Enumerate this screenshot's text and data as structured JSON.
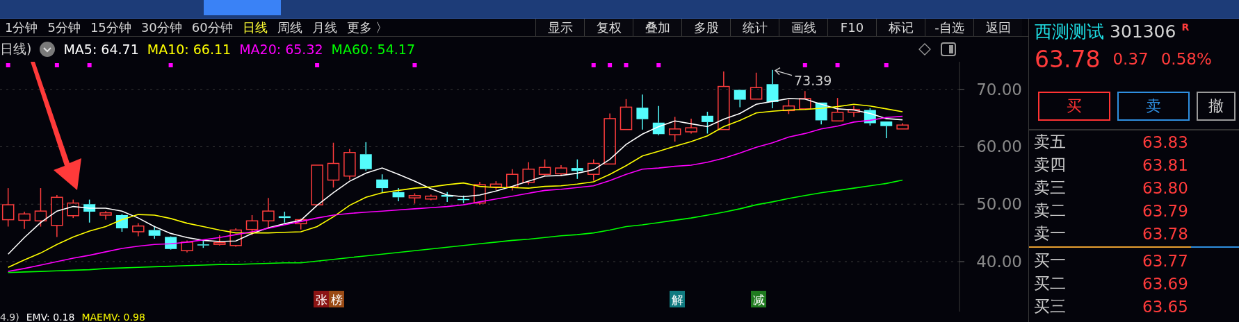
{
  "periods": [
    {
      "label": "1分钟",
      "selected": false
    },
    {
      "label": "5分钟",
      "selected": false
    },
    {
      "label": "15分钟",
      "selected": false
    },
    {
      "label": "30分钟",
      "selected": false
    },
    {
      "label": "60分钟",
      "selected": false
    },
    {
      "label": "日线",
      "selected": true
    },
    {
      "label": "周线",
      "selected": false
    },
    {
      "label": "月线",
      "selected": false
    },
    {
      "label": "更多 〉",
      "selected": false
    }
  ],
  "toolbar": [
    "显示",
    "复权",
    "叠加",
    "多股",
    "统计",
    "画线",
    "F10",
    "标记",
    "-自选",
    "返回"
  ],
  "legend": {
    "prefix": "日线)",
    "values": [
      ": 64.71",
      ": 66.11",
      ": 65.32",
      ": 54.17"
    ]
  },
  "event_tags": [
    {
      "text": "张",
      "color": "#8b1414"
    },
    {
      "text": "榜",
      "color": "#9a4a14"
    },
    {
      "text": "解",
      "color": "#0f7a80"
    },
    {
      "text": "减",
      "color": "#1f7a1f"
    }
  ],
  "chart_data": {
    "type": "candlestick",
    "grid": true,
    "ylim": [
      31.3,
      74.8
    ],
    "yticks": [
      {
        "value": 40,
        "label": "40.00"
      },
      {
        "value": 50,
        "label": "50.00"
      },
      {
        "value": 60,
        "label": "60.00"
      },
      {
        "value": 70,
        "label": "70.00"
      }
    ],
    "series": [
      {
        "name": "MA5",
        "type": "line",
        "color": "#ffffff",
        "values": [
          41.3,
          44.2,
          46.8,
          48.8,
          49.6,
          49.3,
          49.3,
          48.8,
          47.6,
          46.1,
          44.9,
          44.2,
          43.7,
          43.5,
          43.6,
          44.9,
          45.9,
          46.6,
          47.2,
          49.8,
          52.0,
          54.0,
          55.4,
          56.3,
          55.2,
          54.0,
          52.7,
          51.6,
          51.3,
          51.6,
          52.3,
          53.1,
          54.0,
          54.9,
          55.0,
          55.4,
          56.0,
          57.8,
          60.4,
          62.2,
          63.5,
          64.5,
          64.0,
          63.5,
          64.8,
          65.8,
          67.4,
          67.9,
          68.4,
          68.3,
          67.4,
          66.6,
          66.4,
          65.8,
          64.9,
          64.7,
          null,
          null,
          null
        ]
      },
      {
        "name": "MA10",
        "type": "line",
        "color": "#ffff00",
        "values": [
          39.0,
          40.3,
          41.5,
          43.0,
          44.3,
          45.3,
          46.1,
          47.3,
          48.2,
          48.1,
          47.5,
          46.7,
          46.1,
          45.5,
          45.0,
          45.0,
          45.0,
          45.1,
          45.2,
          46.1,
          47.8,
          49.8,
          51.2,
          52.0,
          52.4,
          52.8,
          53.0,
          53.4,
          53.7,
          53.1,
          52.9,
          52.9,
          52.8,
          53.1,
          53.2,
          53.5,
          53.9,
          55.2,
          56.7,
          58.4,
          59.2,
          60.1,
          60.9,
          61.9,
          63.5,
          64.6,
          65.9,
          66.2,
          66.4,
          66.5,
          66.7,
          67.0,
          67.4,
          67.1,
          66.6,
          66.1,
          null,
          null,
          null
        ]
      },
      {
        "name": "MA20",
        "type": "line",
        "color": "#ff00ff",
        "values": [
          38.3,
          38.8,
          39.4,
          40.0,
          40.6,
          41.1,
          41.7,
          42.3,
          42.7,
          43.0,
          43.1,
          43.4,
          43.8,
          44.2,
          44.7,
          45.2,
          45.8,
          46.4,
          47.0,
          47.6,
          48.1,
          48.4,
          48.6,
          48.8,
          49.0,
          49.2,
          49.4,
          49.6,
          49.9,
          50.4,
          50.9,
          51.4,
          51.9,
          52.4,
          52.6,
          52.9,
          53.2,
          54.1,
          55.2,
          56.1,
          56.3,
          56.6,
          56.8,
          57.3,
          58.0,
          58.9,
          59.9,
          60.7,
          61.7,
          62.3,
          63.1,
          63.6,
          64.3,
          64.6,
          65.1,
          65.3,
          null,
          null,
          null
        ]
      },
      {
        "name": "MA60",
        "type": "line",
        "color": "#00ff00",
        "values": [
          38.1,
          38.2,
          38.3,
          38.4,
          38.5,
          38.6,
          38.8,
          38.9,
          39.0,
          39.1,
          39.2,
          39.3,
          39.4,
          39.5,
          39.5,
          39.6,
          39.7,
          39.8,
          39.8,
          40.1,
          40.4,
          40.7,
          41.0,
          41.3,
          41.6,
          41.9,
          42.2,
          42.5,
          42.8,
          43.1,
          43.4,
          43.7,
          43.9,
          44.2,
          44.5,
          44.7,
          45.0,
          45.5,
          46.1,
          46.4,
          46.8,
          47.2,
          47.6,
          48.1,
          48.6,
          49.2,
          49.9,
          50.4,
          51.0,
          51.5,
          52.0,
          52.4,
          52.8,
          53.2,
          53.6,
          54.2,
          null,
          null,
          null
        ]
      }
    ],
    "ohlc": [
      [
        47.3,
        52.8,
        46.1,
        49.9
      ],
      [
        47.2,
        48.7,
        45.7,
        48.3
      ],
      [
        47.1,
        52.8,
        46.1,
        48.8
      ],
      [
        46.3,
        51.6,
        44.3,
        51.2
      ],
      [
        48.0,
        50.8,
        47.6,
        50.2
      ],
      [
        50.0,
        50.8,
        46.8,
        48.7
      ],
      [
        48.1,
        48.8,
        47.3,
        48.5
      ],
      [
        48.1,
        48.3,
        45.2,
        45.8
      ],
      [
        45.2,
        46.7,
        44.4,
        46.2
      ],
      [
        45.5,
        46.2,
        44.0,
        44.5
      ],
      [
        44.3,
        44.4,
        42.1,
        42.2
      ],
      [
        41.9,
        43.7,
        41.6,
        43.4
      ],
      [
        43.0,
        43.6,
        42.4,
        42.9
      ],
      [
        43.0,
        44.6,
        42.8,
        43.3
      ],
      [
        42.8,
        45.8,
        42.6,
        45.5
      ],
      [
        45.6,
        48.1,
        44.6,
        47.1
      ],
      [
        47.1,
        51.1,
        45.8,
        48.8
      ],
      [
        47.9,
        48.7,
        46.8,
        47.6
      ],
      [
        46.6,
        47.5,
        45.6,
        47.3
      ],
      [
        49.9,
        56.8,
        49.9,
        56.8
      ],
      [
        54.2,
        60.7,
        52.9,
        57.1
      ],
      [
        54.9,
        59.6,
        54.3,
        59.0
      ],
      [
        58.7,
        60.8,
        55.8,
        56.1
      ],
      [
        54.3,
        55.2,
        52.0,
        52.8
      ],
      [
        52.1,
        52.8,
        50.5,
        51.2
      ],
      [
        51.1,
        51.9,
        50.1,
        51.5
      ],
      [
        50.9,
        51.7,
        50.7,
        51.4
      ],
      [
        51.6,
        52.1,
        50.4,
        51.3
      ],
      [
        50.9,
        51.5,
        50.2,
        50.8
      ],
      [
        50.2,
        53.9,
        49.9,
        53.4
      ],
      [
        53.0,
        54.0,
        52.5,
        53.5
      ],
      [
        53.0,
        56.1,
        52.4,
        55.2
      ],
      [
        53.8,
        57.3,
        53.4,
        56.1
      ],
      [
        55.2,
        57.8,
        54.9,
        56.4
      ],
      [
        55.3,
        56.8,
        54.9,
        56.3
      ],
      [
        56.3,
        57.8,
        54.4,
        55.8
      ],
      [
        55.2,
        57.8,
        54.1,
        57.1
      ],
      [
        57.0,
        65.8,
        57.0,
        64.9
      ],
      [
        63.0,
        68.3,
        63.0,
        66.9
      ],
      [
        66.8,
        69.1,
        63.0,
        64.8
      ],
      [
        64.2,
        67.1,
        62.0,
        62.2
      ],
      [
        62.1,
        65.2,
        60.9,
        63.1
      ],
      [
        62.6,
        64.9,
        62.3,
        63.3
      ],
      [
        65.4,
        66.1,
        62.3,
        64.3
      ],
      [
        63.0,
        73.1,
        63.0,
        70.5
      ],
      [
        69.9,
        69.9,
        66.9,
        68.2
      ],
      [
        68.3,
        72.9,
        68.3,
        70.3
      ],
      [
        70.9,
        73.39,
        66.7,
        67.8
      ],
      [
        66.3,
        68.2,
        65.7,
        67.1
      ],
      [
        66.6,
        69.7,
        66.6,
        68.4
      ],
      [
        67.7,
        67.7,
        63.9,
        64.6
      ],
      [
        64.5,
        68.5,
        64.5,
        66.0
      ],
      [
        66.0,
        67.1,
        65.2,
        66.5
      ],
      [
        66.4,
        66.7,
        63.7,
        64.1
      ],
      [
        64.4,
        64.4,
        61.5,
        63.6
      ],
      [
        63.1,
        64.1,
        63.1,
        63.78
      ],
      null,
      null,
      null
    ],
    "annotations": [
      {
        "text": "73.39"
      }
    ]
  },
  "indicator_row": {
    "prefix": "4.9)",
    "items": [
      {
        "label": "EMV: 0.18",
        "color": "#ffffff"
      },
      {
        "label": "MAEMV: 0.98",
        "color": "#ffff00"
      }
    ]
  },
  "quote": {
    "name": "西测测试",
    "code": "301306",
    "badge": "R",
    "price": "63.78",
    "change": "0.37",
    "change_pct": "0.58%"
  },
  "trade_buttons": [
    {
      "label": "买",
      "kind": "buy"
    },
    {
      "label": "卖",
      "kind": "sell"
    },
    {
      "label": "撤",
      "kind": "cancel"
    }
  ],
  "order_book": {
    "asks": [
      {
        "label": "卖五",
        "price": "63.83"
      },
      {
        "label": "卖四",
        "price": "63.81"
      },
      {
        "label": "卖三",
        "price": "63.80"
      },
      {
        "label": "卖二",
        "price": "63.79"
      },
      {
        "label": "卖一",
        "price": "63.78"
      }
    ],
    "bids": [
      {
        "label": "买一",
        "price": "63.77"
      },
      {
        "label": "买二",
        "price": "63.69"
      },
      {
        "label": "买三",
        "price": "63.65"
      }
    ]
  }
}
